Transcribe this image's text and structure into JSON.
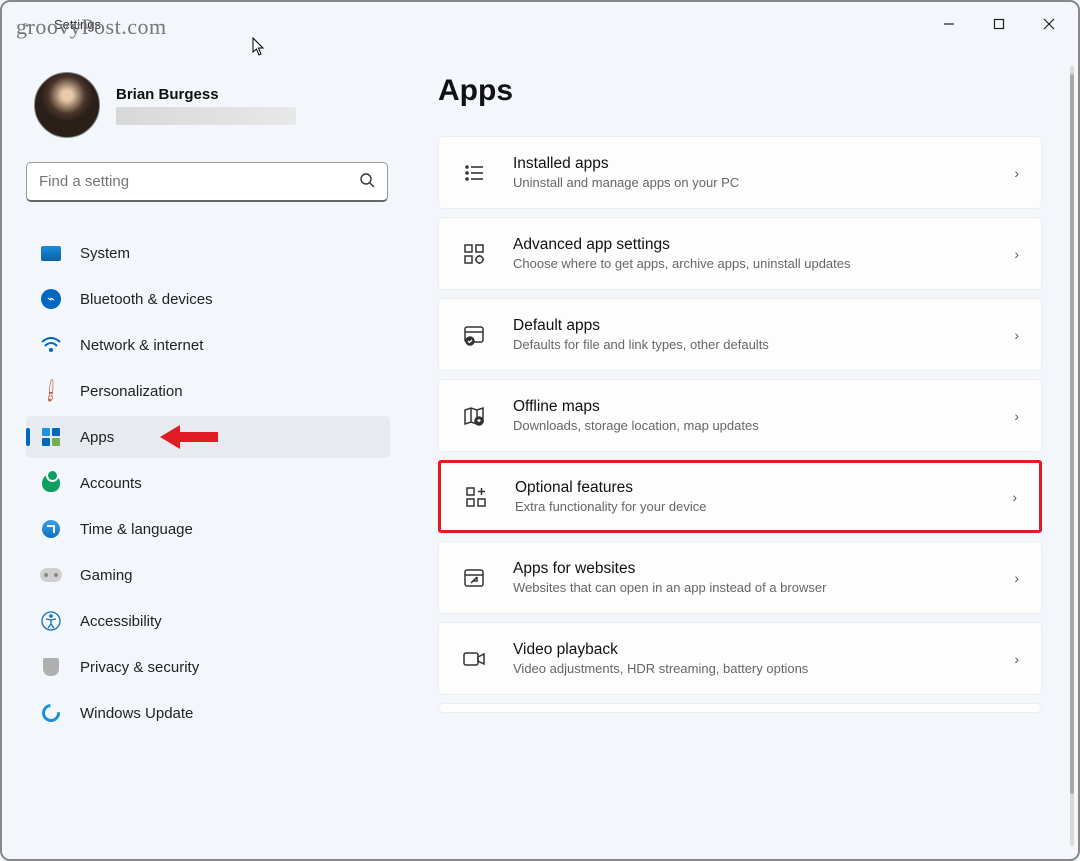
{
  "watermark": "groovyPost.com",
  "window": {
    "title": "Settings"
  },
  "profile": {
    "name": "Brian Burgess"
  },
  "search": {
    "placeholder": "Find a setting"
  },
  "nav": {
    "items": [
      {
        "label": "System"
      },
      {
        "label": "Bluetooth & devices"
      },
      {
        "label": "Network & internet"
      },
      {
        "label": "Personalization"
      },
      {
        "label": "Apps"
      },
      {
        "label": "Accounts"
      },
      {
        "label": "Time & language"
      },
      {
        "label": "Gaming"
      },
      {
        "label": "Accessibility"
      },
      {
        "label": "Privacy & security"
      },
      {
        "label": "Windows Update"
      }
    ]
  },
  "page": {
    "title": "Apps"
  },
  "cards": [
    {
      "title": "Installed apps",
      "sub": "Uninstall and manage apps on your PC"
    },
    {
      "title": "Advanced app settings",
      "sub": "Choose where to get apps, archive apps, uninstall updates"
    },
    {
      "title": "Default apps",
      "sub": "Defaults for file and link types, other defaults"
    },
    {
      "title": "Offline maps",
      "sub": "Downloads, storage location, map updates"
    },
    {
      "title": "Optional features",
      "sub": "Extra functionality for your device"
    },
    {
      "title": "Apps for websites",
      "sub": "Websites that can open in an app instead of a browser"
    },
    {
      "title": "Video playback",
      "sub": "Video adjustments, HDR streaming, battery options"
    }
  ]
}
